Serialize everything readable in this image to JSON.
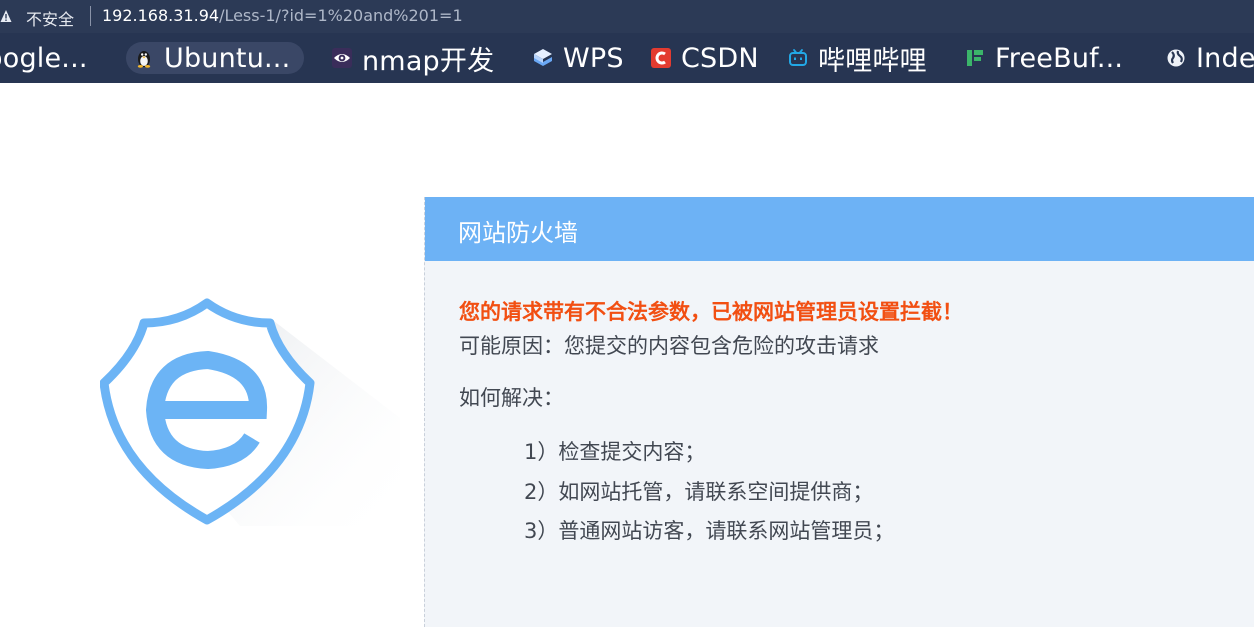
{
  "address_bar": {
    "security_label": "不安全",
    "url_host": "192.168.31.94",
    "url_path": "/Less-1/?id=1%20and%201=1"
  },
  "bookmarks": [
    {
      "label": "oogle...",
      "icon": "google-icon"
    },
    {
      "label": "Ubuntu...",
      "icon": "tux-icon"
    },
    {
      "label": "nmap开发",
      "icon": "eye-icon"
    },
    {
      "label": "WPS",
      "icon": "wps-icon"
    },
    {
      "label": "CSDN",
      "icon": "csdn-icon"
    },
    {
      "label": "哔哩哔哩",
      "icon": "bilibili-icon"
    },
    {
      "label": "FreeBuf...",
      "icon": "freebuf-icon"
    },
    {
      "label": "Inde",
      "icon": "globe-icon"
    }
  ],
  "firewall": {
    "header": "网站防火墙",
    "title": "您的请求带有不合法参数，已被网站管理员设置拦截！",
    "reason": "可能原因：您提交的内容包含危险的攻击请求",
    "how_label": "如何解决：",
    "steps": [
      "1）检查提交内容；",
      "2）如网站托管，请联系空间提供商；",
      "3）普通网站访客，请联系网站管理员；"
    ]
  },
  "colors": {
    "address_bar_bg": "#2c3a56",
    "bookmarks_bg": "#273552",
    "header_blue": "#6db2f5",
    "error_orange": "#f24f12",
    "logo_blue": "#6cb4f5"
  }
}
